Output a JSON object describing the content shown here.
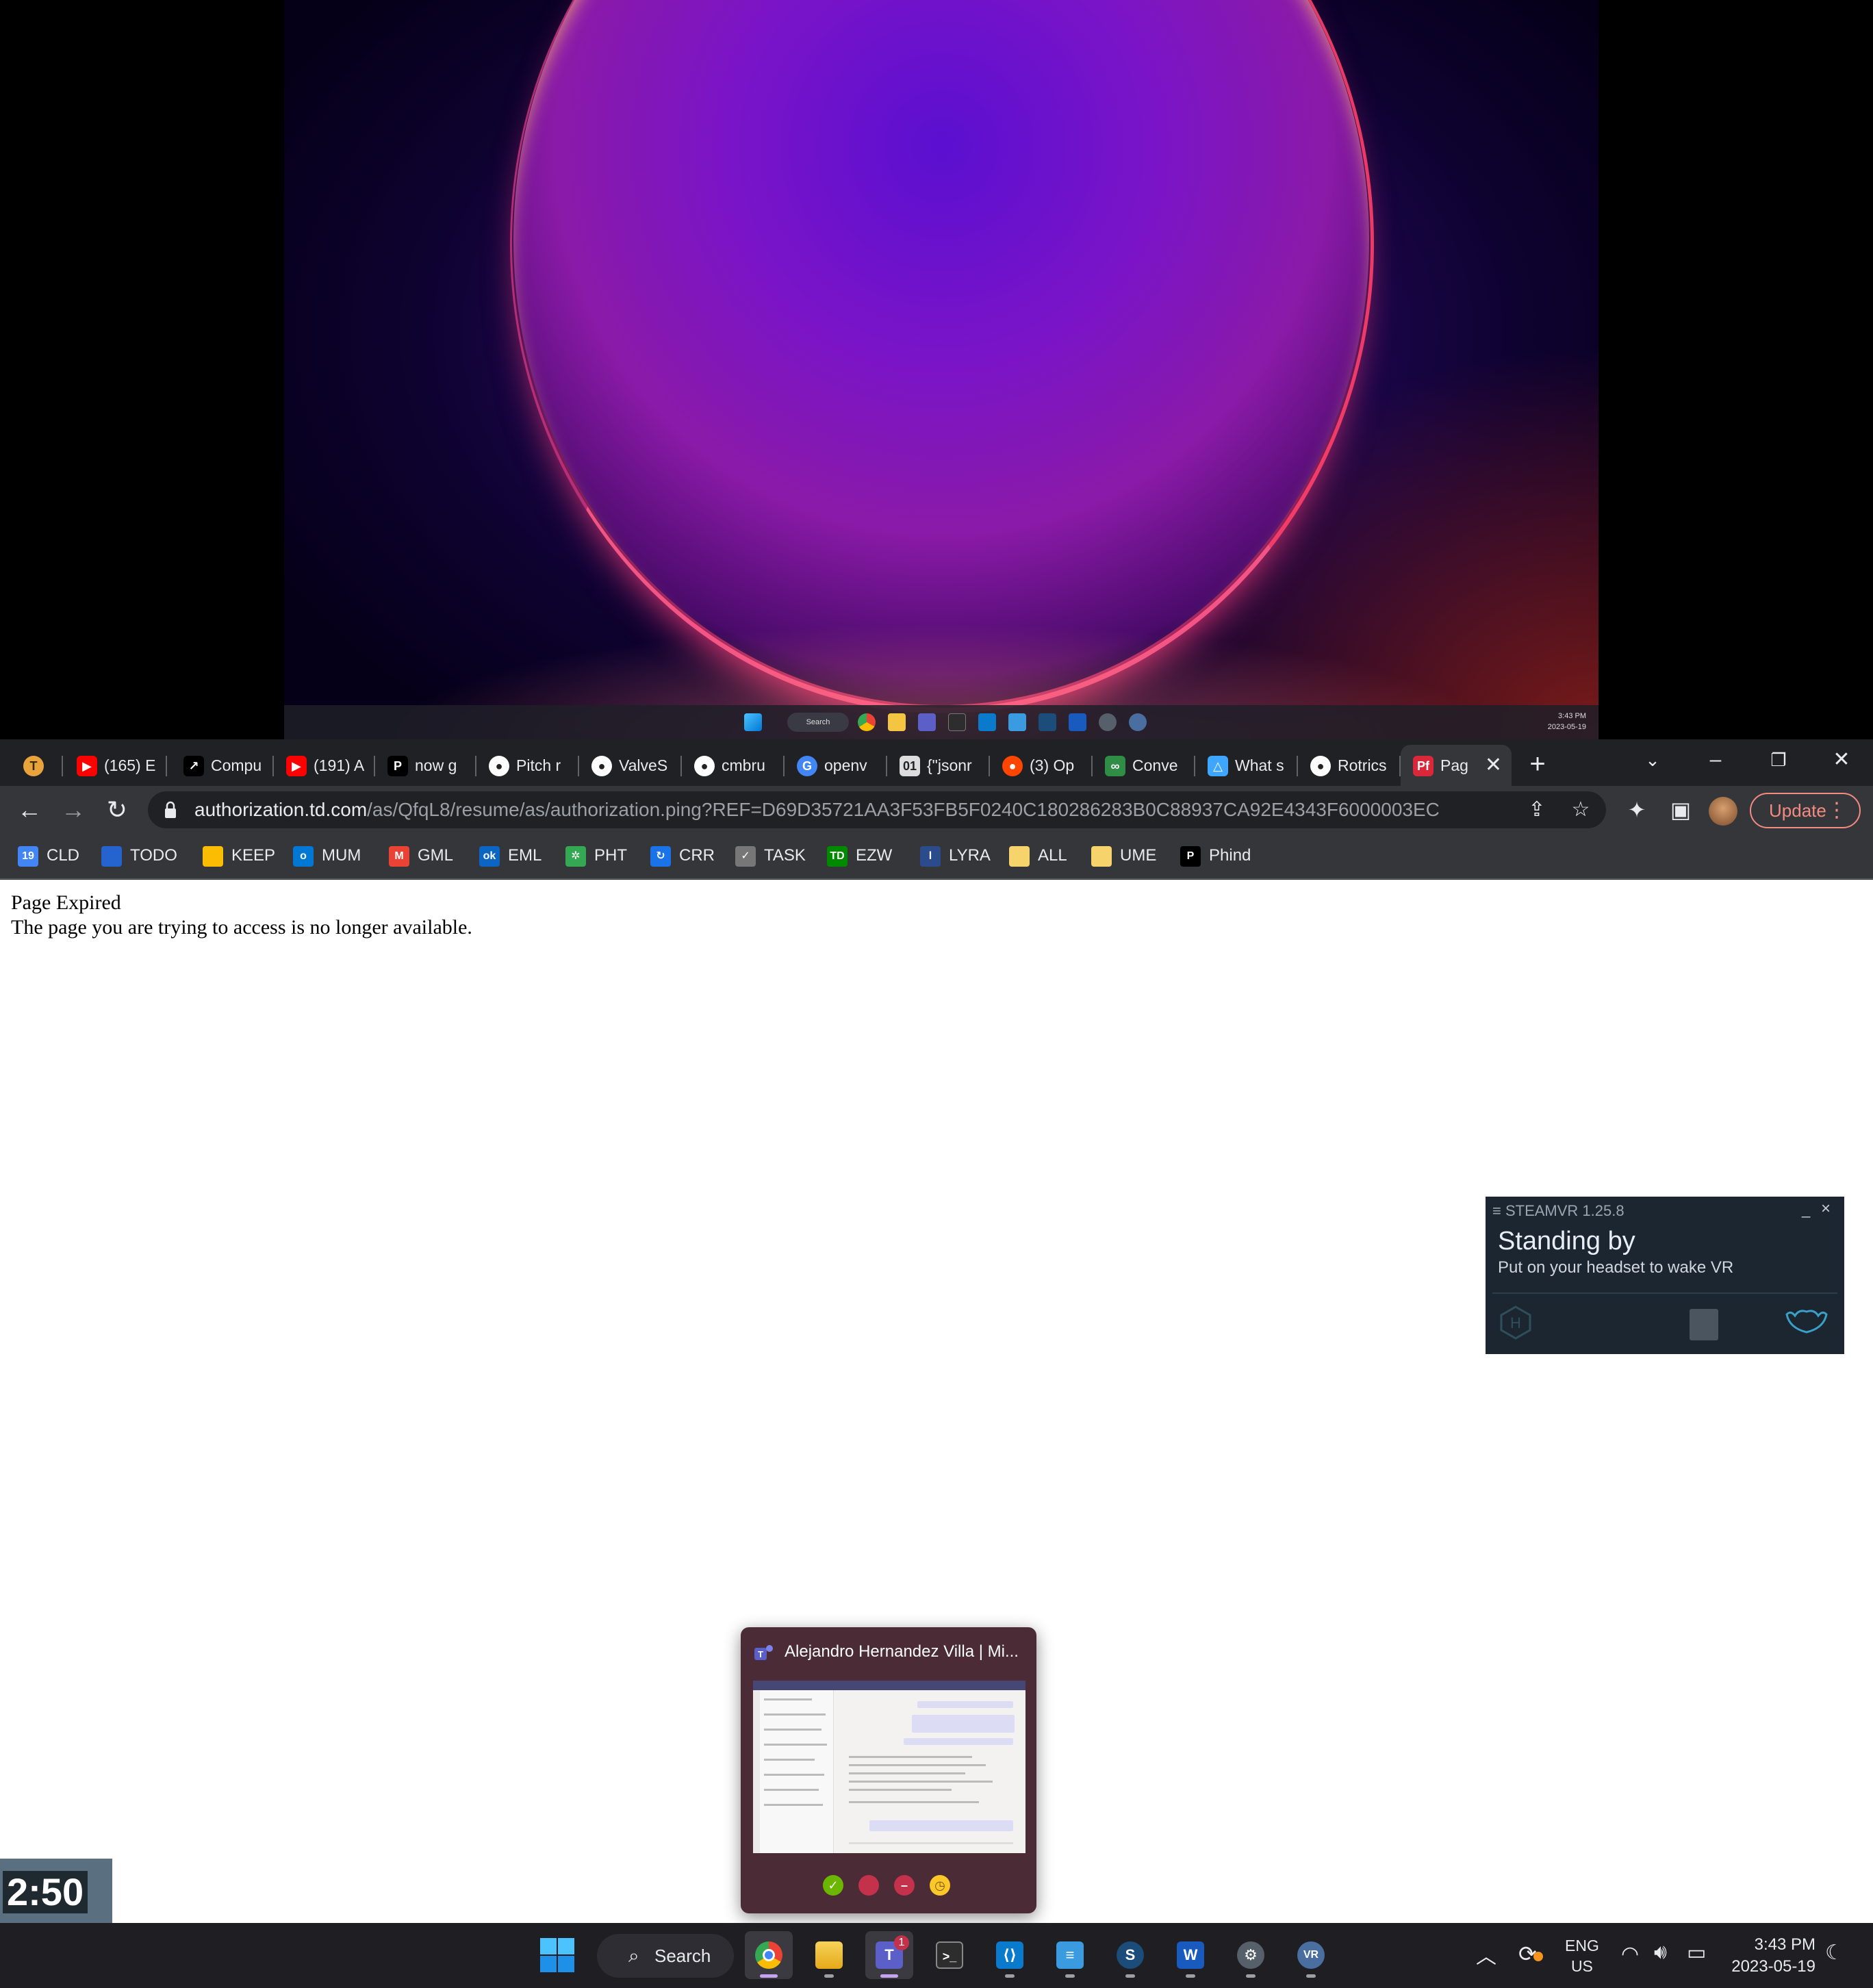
{
  "mini_taskbar": {
    "search_label": "Search",
    "time": "3:43 PM",
    "date": "2023-05-19"
  },
  "browser": {
    "tabs": [
      {
        "label": "",
        "icon": "tasks-t-icon",
        "color": "#e8a33d"
      },
      {
        "label": "(165) E",
        "icon": "youtube-icon",
        "color": "#ff0000"
      },
      {
        "label": "Compu",
        "icon": "arrow-icon",
        "color": "#000000"
      },
      {
        "label": "(191) A",
        "icon": "youtube-icon",
        "color": "#ff0000"
      },
      {
        "label": "now g",
        "icon": "p-icon",
        "color": "#000000"
      },
      {
        "label": "Pitch r",
        "icon": "github-icon",
        "color": "#ffffff"
      },
      {
        "label": "ValveS",
        "icon": "github-icon",
        "color": "#ffffff"
      },
      {
        "label": "cmbru",
        "icon": "github-icon",
        "color": "#ffffff"
      },
      {
        "label": "openv",
        "icon": "google-icon",
        "color": "#4285f4"
      },
      {
        "label": "{\"jsonr",
        "icon": "binary-icon",
        "color": "#dddddd"
      },
      {
        "label": "(3) Op",
        "icon": "reddit-icon",
        "color": "#ff4500"
      },
      {
        "label": "Conve",
        "icon": "geeks-icon",
        "color": "#2f8d46"
      },
      {
        "label": "What s",
        "icon": "triangle-icon",
        "color": "#3ea6ff"
      },
      {
        "label": "Rotrics",
        "icon": "github-icon",
        "color": "#ffffff"
      },
      {
        "label": "Pag",
        "icon": "pf-icon",
        "color": "#d9283a"
      }
    ],
    "url_host": "authorization.td.com",
    "url_path": "/as/QfqL8/resume/as/authorization.ping?REF=D69D35721AA3F53FB5F0240C180286283B0C88937CA92E4343F6000003EC",
    "update_label": "Update",
    "bookmarks": [
      {
        "label": "CLD",
        "icon": "calendar-icon",
        "color": "#4285f4",
        "glyph": "19"
      },
      {
        "label": "TODO",
        "icon": "todo-icon",
        "color": "#2564cf",
        "glyph": ""
      },
      {
        "label": "KEEP",
        "icon": "keep-icon",
        "color": "#fbbc04",
        "glyph": ""
      },
      {
        "label": "MUM",
        "icon": "outlook-icon",
        "color": "#0078d4",
        "glyph": "o"
      },
      {
        "label": "GML",
        "icon": "gmail-icon",
        "color": "#ea4335",
        "glyph": "M"
      },
      {
        "label": "EML",
        "icon": "email-icon",
        "color": "#0a66c2",
        "glyph": "ok"
      },
      {
        "label": "PHT",
        "icon": "photos-icon",
        "color": "#34a853",
        "glyph": "✲"
      },
      {
        "label": "CRR",
        "icon": "sync-icon",
        "color": "#1a73e8",
        "glyph": "↻"
      },
      {
        "label": "TASK",
        "icon": "task-icon",
        "color": "#777777",
        "glyph": "✓"
      },
      {
        "label": "EZW",
        "icon": "td-icon",
        "color": "#008a00",
        "glyph": "TD"
      },
      {
        "label": "LYRA",
        "icon": "lyra-icon",
        "color": "#2b4b8c",
        "glyph": "l"
      },
      {
        "label": "ALL",
        "icon": "note-icon",
        "color": "#f6d36b",
        "glyph": ""
      },
      {
        "label": "UME",
        "icon": "note-icon",
        "color": "#f6d36b",
        "glyph": ""
      },
      {
        "label": "Phind",
        "icon": "phind-icon",
        "color": "#000000",
        "glyph": "P"
      }
    ]
  },
  "page": {
    "title": "Page Expired",
    "message": "The page you are trying to access is no longer available."
  },
  "steamvr": {
    "title": "STEAMVR 1.25.8",
    "status": "Standing by",
    "hint": "Put on your headset to wake VR"
  },
  "teams_preview": {
    "title": "Alejandro Hernandez Villa | Mi..."
  },
  "timer": {
    "value": "2:50"
  },
  "taskbar": {
    "search_label": "Search",
    "lang_top": "ENG",
    "lang_bottom": "US",
    "time": "3:43 PM",
    "date": "2023-05-19",
    "teams_badge": "1"
  }
}
